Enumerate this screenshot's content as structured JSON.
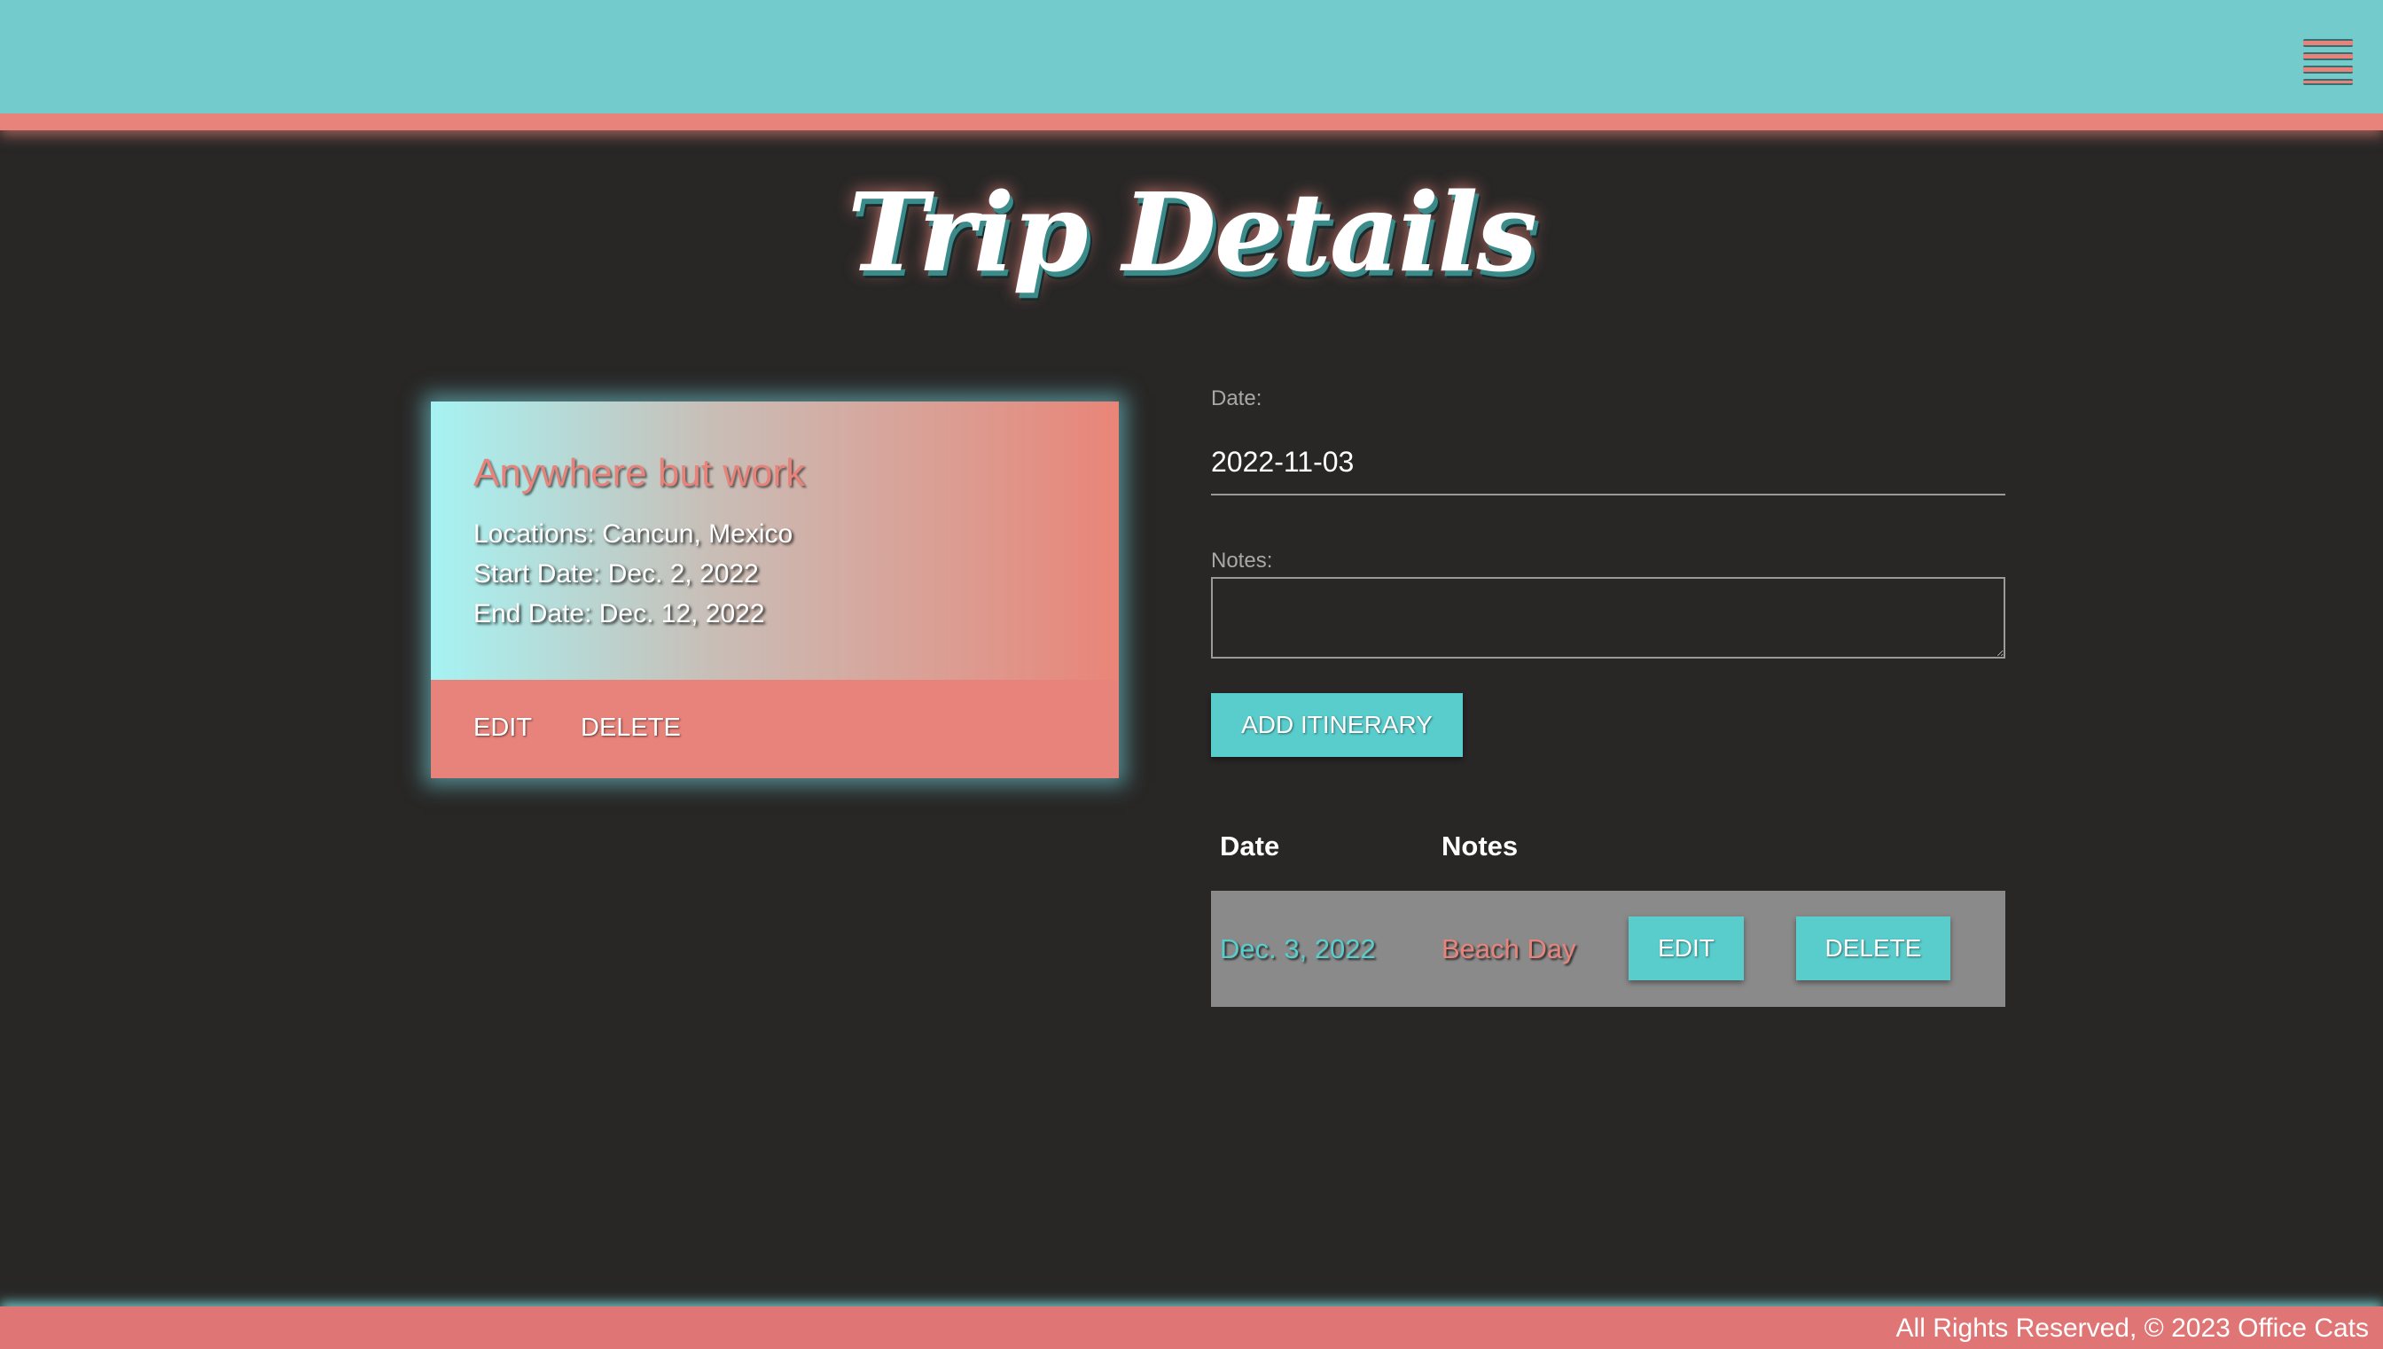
{
  "colors": {
    "header_bg": "#74cbcb",
    "accent_coral": "#e7837a",
    "accent_teal": "#59cccc",
    "page_bg": "#282726",
    "row_bg": "#8a8a8a",
    "footer_bg": "#e07575"
  },
  "header": {
    "menu_icon": "hamburger-menu-icon"
  },
  "page": {
    "title": "Trip Details"
  },
  "trip": {
    "name": "Anywhere but work",
    "locations": "Locations: Cancun, Mexico",
    "start_date": "Start Date: Dec. 2, 2022",
    "end_date": "End Date: Dec. 12, 2022",
    "edit_label": "EDIT",
    "delete_label": "DELETE"
  },
  "form": {
    "date_label": "Date:",
    "date_value": "2022-11-03",
    "notes_label": "Notes:",
    "notes_value": "",
    "add_button": "ADD ITINERARY"
  },
  "itinerary": {
    "columns": [
      "Date",
      "Notes"
    ],
    "rows": [
      {
        "date": "Dec. 3, 2022",
        "notes": "Beach Day",
        "edit_label": "EDIT",
        "delete_label": "DELETE"
      }
    ]
  },
  "footer": {
    "text": "All Rights Reserved, © 2023 Office Cats"
  }
}
